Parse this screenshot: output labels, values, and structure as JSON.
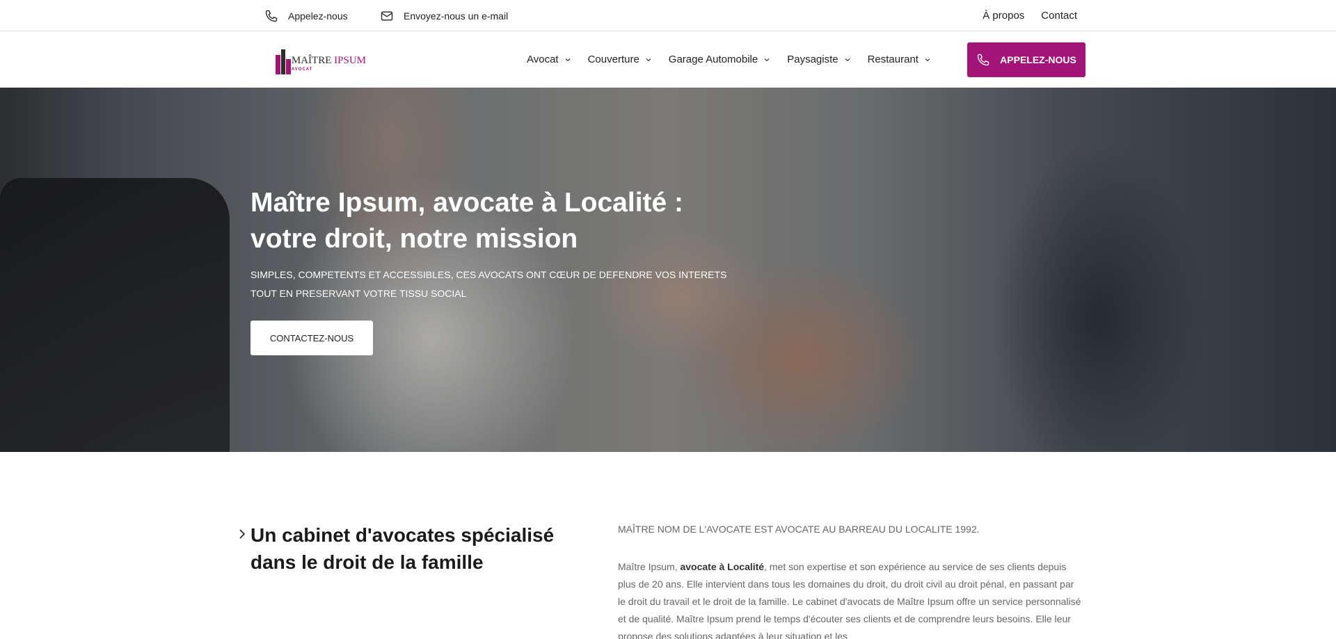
{
  "topbar": {
    "call_label": "Appelez-nous",
    "mail_label": "Envoyez-nous un e-mail",
    "about_label": "À propos",
    "contact_label": "Contact"
  },
  "logo": {
    "name_part1": "MAÎTRE",
    "name_part2": "IPSUM",
    "tagline": "AVOCAT"
  },
  "nav": {
    "items": [
      {
        "label": "Avocat"
      },
      {
        "label": "Couverture"
      },
      {
        "label": "Garage Automobile"
      },
      {
        "label": "Paysagiste"
      },
      {
        "label": "Restaurant"
      }
    ],
    "cta_label": "APPELEZ-NOUS"
  },
  "hero": {
    "title": "Maître Ipsum, avocate à Localité : votre droit, notre mission",
    "subtitle": "SIMPLES, COMPETENTS ET ACCESSIBLES, CES AVOCATS ONT CŒUR DE DEFENDRE VOS INTERETS TOUT EN PRESERVANT VOTRE TISSU SOCIAL",
    "button_label": "CONTACTEZ-NOUS"
  },
  "content": {
    "heading": "Un cabinet d'avocates spécialisé dans le droit de la famille",
    "intro": "MAÎTRE NOM DE L'AVOCATE EST AVOCATE AU BARREAU DU LOCALITE 1992.",
    "para_start": "Maître Ipsum, ",
    "para_bold": "avocate à Localité",
    "para_rest": ", met son expertise et son expérience au service de ses clients depuis plus de 20 ans. Elle intervient dans tous les domaines du droit, du droit civil au droit pénal, en passant par le droit du travail et le droit de la famille. Le cabinet d'avocats de Maître Ipsum offre un service personnalisé et de qualité. Maître Ipsum prend le temps d'écouter ses clients et de comprendre leurs besoins. Elle leur propose des solutions adaptées à leur situation et les"
  },
  "colors": {
    "accent": "#a31478",
    "text": "#222222",
    "muted": "#666666"
  },
  "icons": {
    "phone": "phone-icon",
    "mail": "mail-icon",
    "chevron": "chevron-down-icon",
    "arrow": "chevron-right-icon"
  }
}
